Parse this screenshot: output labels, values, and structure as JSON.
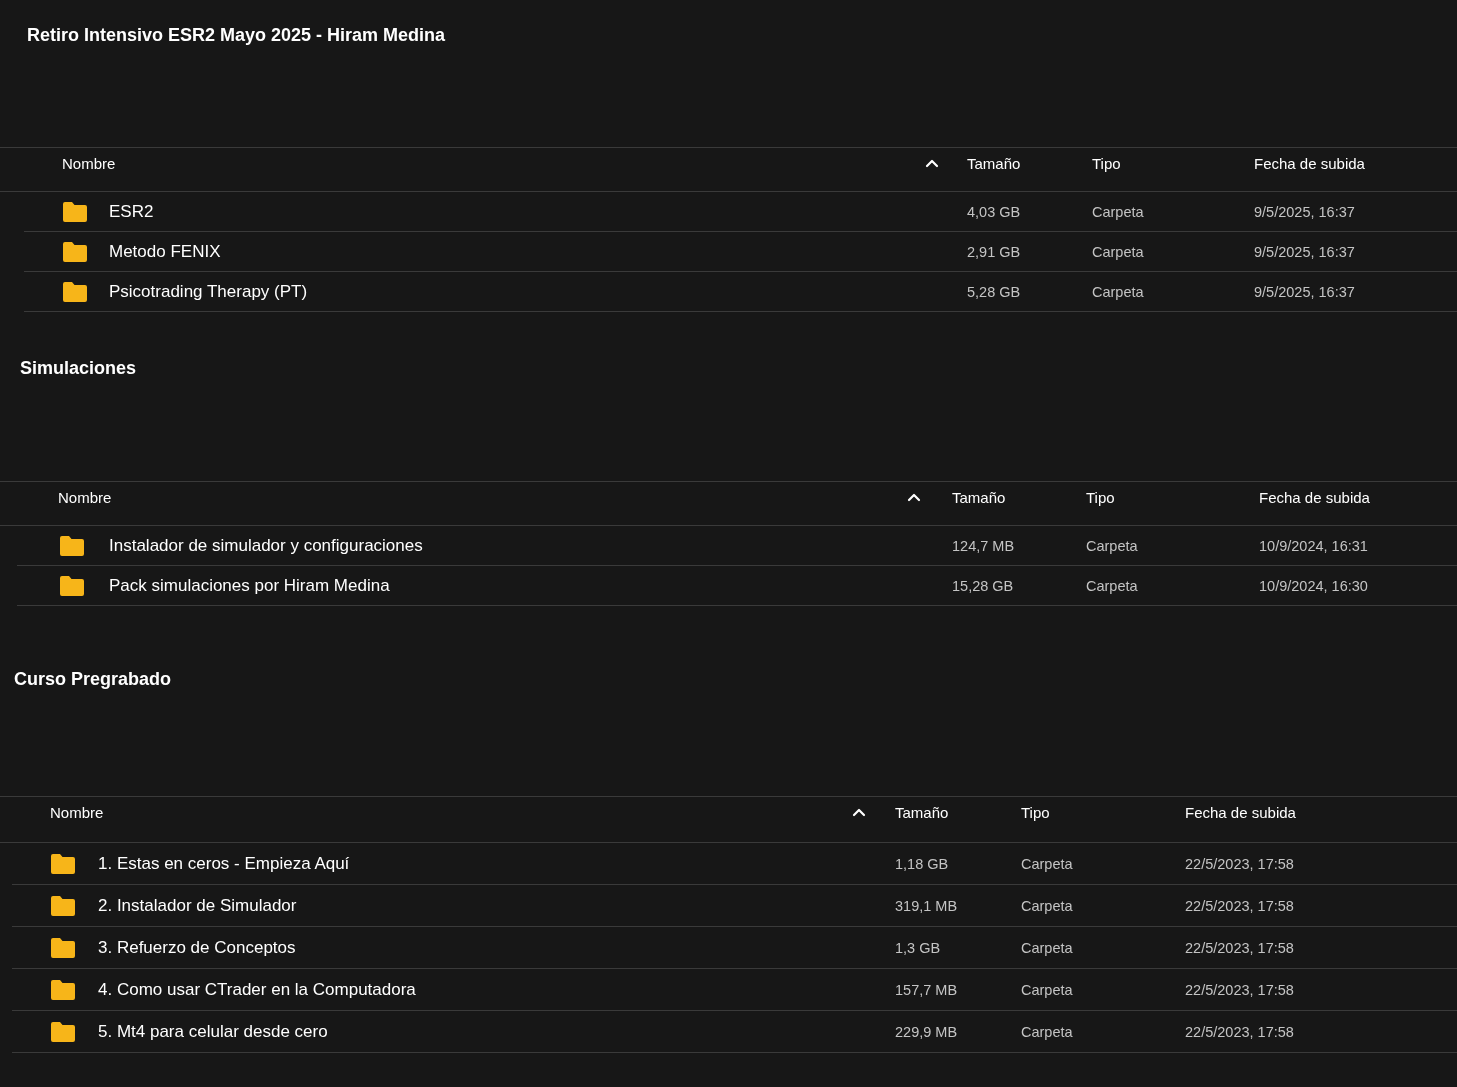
{
  "sections": [
    {
      "heading": "Retiro Intensivo ESR2 Mayo 2025 - Hiram Medina",
      "columns": [
        "Nombre",
        "Tamaño",
        "Tipo",
        "Fecha de subida"
      ],
      "rows": [
        {
          "name": "ESR2",
          "size": "4,03 GB",
          "type": "Carpeta",
          "date": "9/5/2025, 16:37"
        },
        {
          "name": "Metodo FENIX",
          "size": "2,91 GB",
          "type": "Carpeta",
          "date": "9/5/2025, 16:37"
        },
        {
          "name": "Psicotrading Therapy (PT)",
          "size": "5,28 GB",
          "type": "Carpeta",
          "date": "9/5/2025, 16:37"
        }
      ]
    },
    {
      "heading": "Simulaciones",
      "columns": [
        "Nombre",
        "Tamaño",
        "Tipo",
        "Fecha de subida"
      ],
      "rows": [
        {
          "name": "Instalador de simulador y configuraciones",
          "size": "124,7 MB",
          "type": "Carpeta",
          "date": "10/9/2024, 16:31"
        },
        {
          "name": "Pack simulaciones por Hiram Medina",
          "size": "15,28 GB",
          "type": "Carpeta",
          "date": "10/9/2024, 16:30"
        }
      ]
    },
    {
      "heading": "Curso Pregrabado",
      "columns": [
        "Nombre",
        "Tamaño",
        "Tipo",
        "Fecha de subida"
      ],
      "rows": [
        {
          "name": "1. Estas en ceros - Empieza Aquí",
          "size": "1,18 GB",
          "type": "Carpeta",
          "date": "22/5/2023, 17:58"
        },
        {
          "name": "2. Instalador de Simulador",
          "size": "319,1 MB",
          "type": "Carpeta",
          "date": "22/5/2023, 17:58"
        },
        {
          "name": "3. Refuerzo de Conceptos",
          "size": "1,3 GB",
          "type": "Carpeta",
          "date": "22/5/2023, 17:58"
        },
        {
          "name": "4. Como usar CTrader en la Computadora",
          "size": "157,7 MB",
          "type": "Carpeta",
          "date": "22/5/2023, 17:58"
        },
        {
          "name": "5. Mt4 para celular desde cero",
          "size": "229,9 MB",
          "type": "Carpeta",
          "date": "22/5/2023, 17:58"
        }
      ]
    }
  ]
}
